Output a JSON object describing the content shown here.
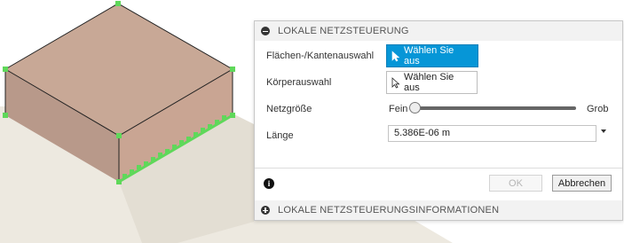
{
  "dialog": {
    "section_title": "LOKALE NETZSTEUERUNG",
    "face_edge_label": "Flächen-/Kantenauswahl",
    "face_edge_button": "Wählen Sie aus",
    "body_label": "Körperauswahl",
    "body_button": "Wählen Sie aus",
    "mesh_size_label": "Netzgröße",
    "mesh_fine": "Fein",
    "mesh_coarse": "Grob",
    "mesh_size_level": 0.0,
    "length_label": "Länge",
    "length_value": "5.386E-06 m",
    "ok_label": "OK",
    "cancel_label": "Abbrechen",
    "info_section_title": "LOKALE NETZSTEUERUNGSINFORMATIONEN",
    "info_icon": "i"
  },
  "scene": {
    "top_face_color": "#c8a896",
    "front_face_color": "#b8998a",
    "side_face_color": "#c9a593",
    "ground_color": "#ede9e0",
    "ground_shade_color": "#e1ddd2",
    "highlight_color": "#5fd85a",
    "accent_color": "#0696d7"
  }
}
